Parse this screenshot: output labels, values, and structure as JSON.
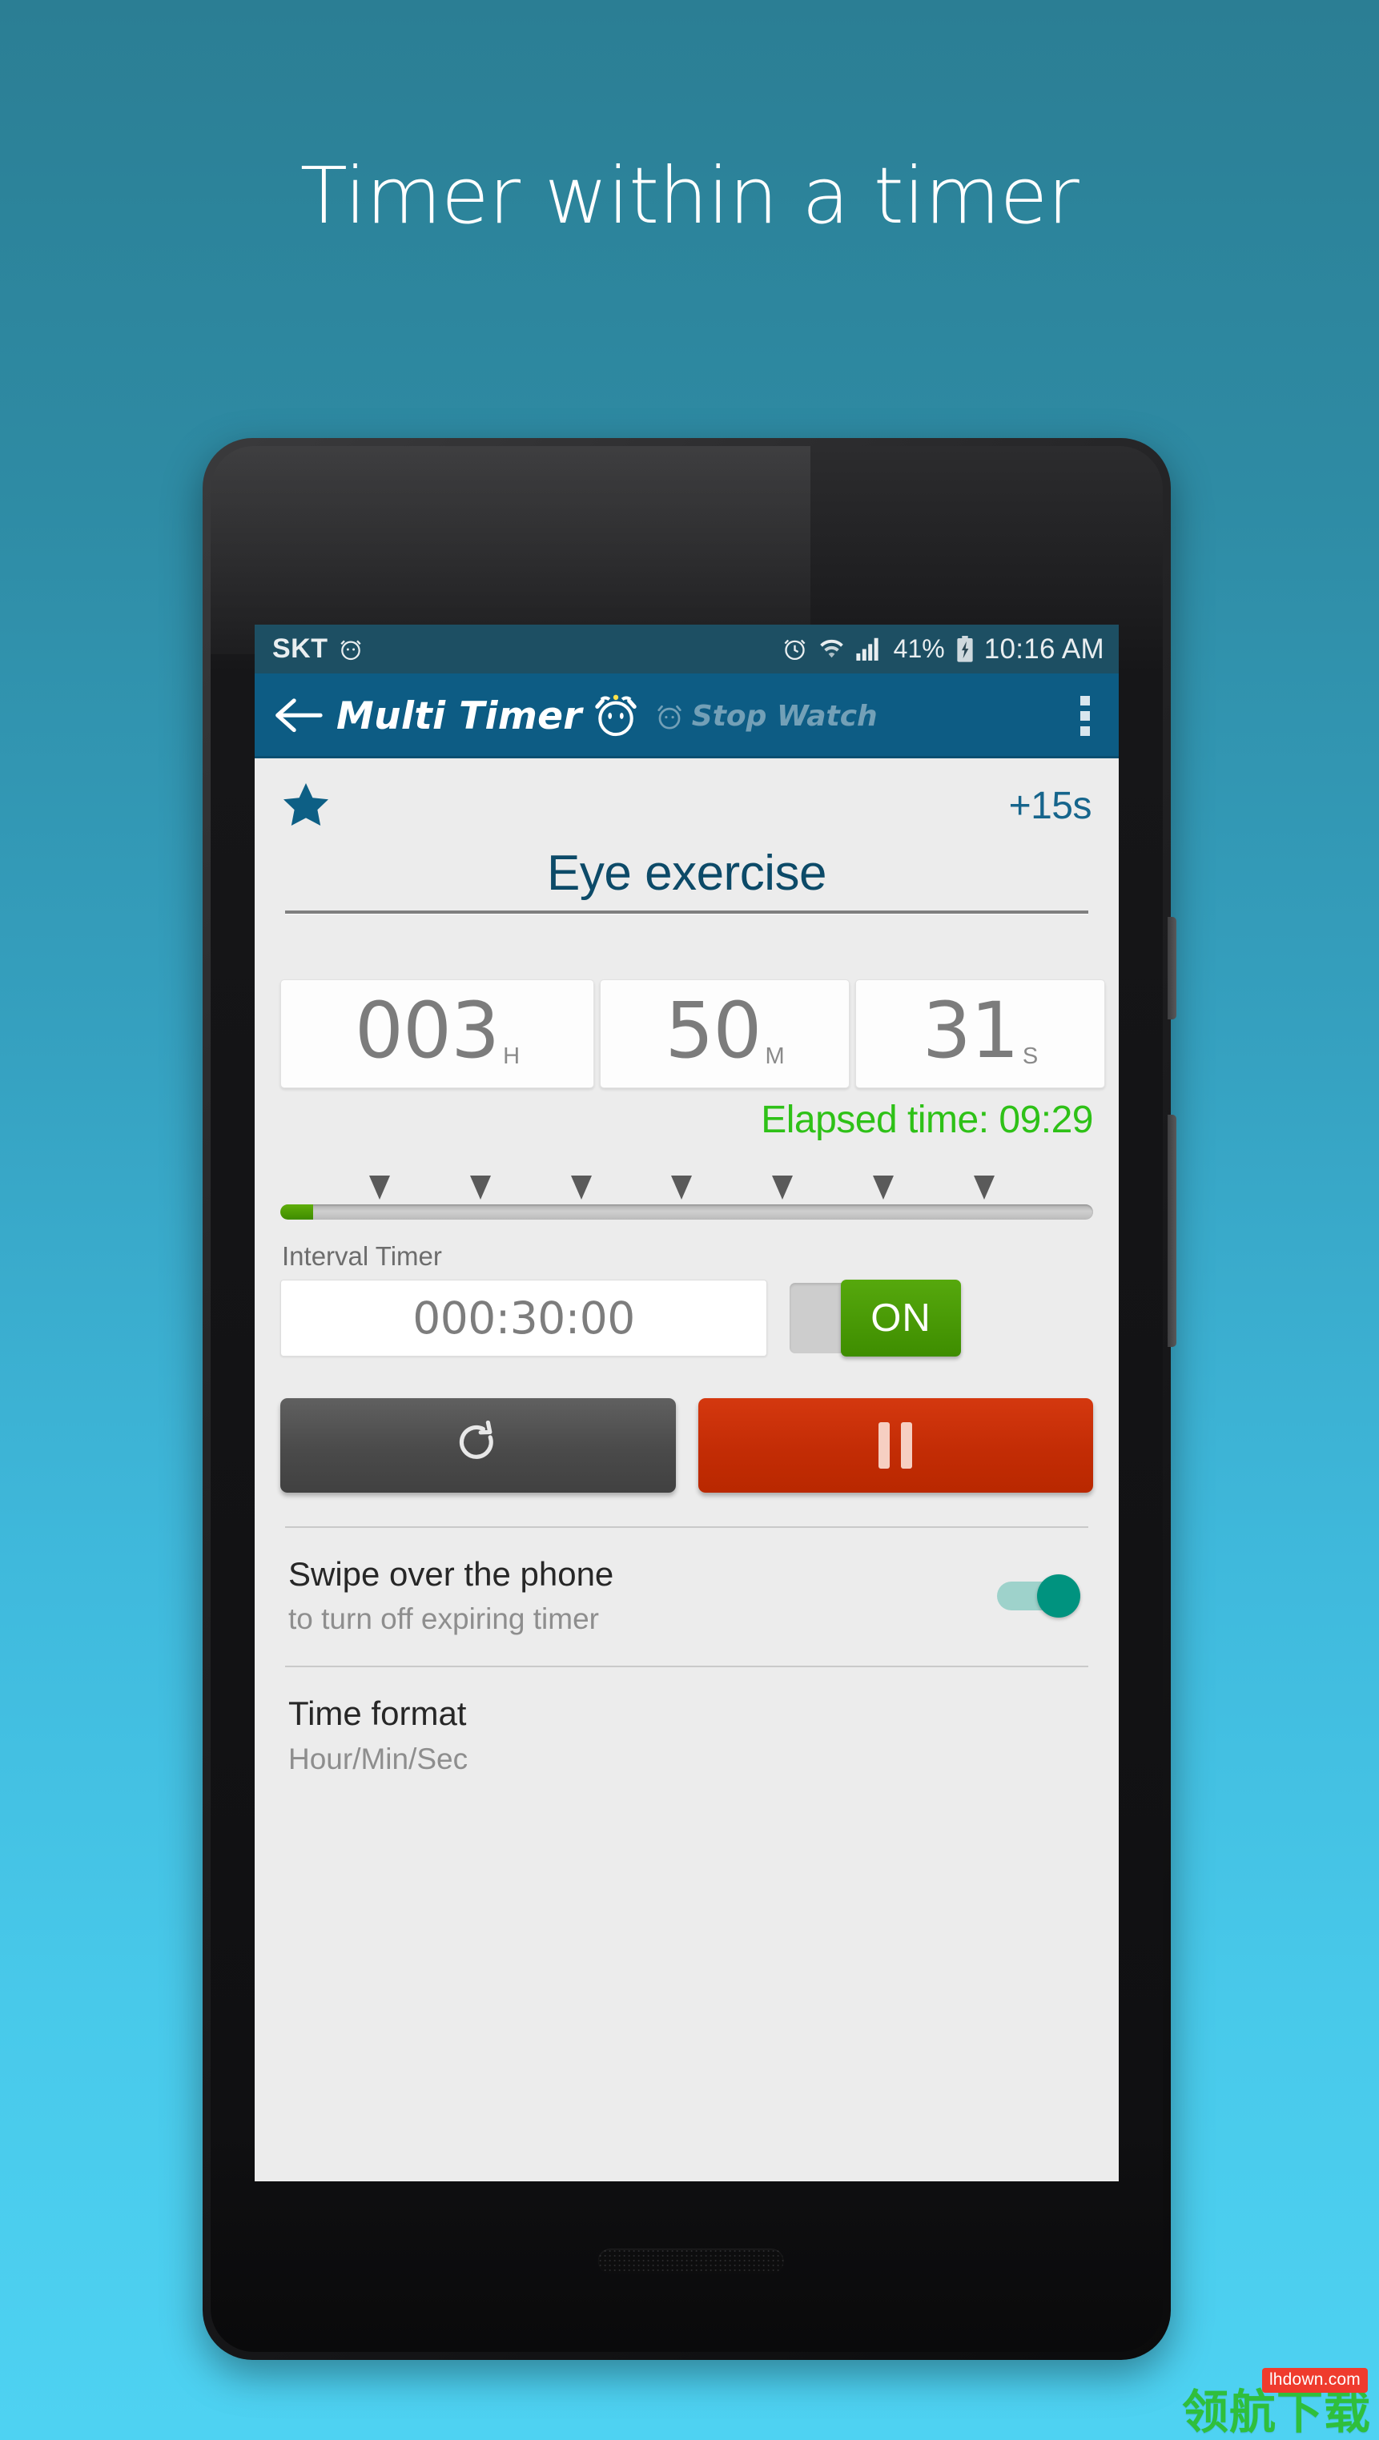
{
  "promo": {
    "headline": "Timer within a timer"
  },
  "statusbar": {
    "carrier": "SKT",
    "carrier_icon": "alarm-clock-icon",
    "alarm_icon": "alarm-clock-icon",
    "wifi_icon": "wifi-icon",
    "signal_icon": "cellular-signal-icon",
    "battery_percent": "41%",
    "battery_icon": "battery-charging-icon",
    "clock": "10:16 AM"
  },
  "appbar": {
    "back_icon": "back-arrow-icon",
    "title": "Multi Timer",
    "logo_icon": "alarm-clock-face-icon",
    "tab_stopwatch_icon": "stopwatch-icon",
    "tab_stopwatch_label": "Stop Watch",
    "overflow_icon": "overflow-menu-icon",
    "bar_color": "#0d5c84"
  },
  "timer": {
    "favorite_icon": "star-icon",
    "add_time_label": "+15s",
    "name": "Eye exercise",
    "digits": [
      {
        "value": "003",
        "unit": "H",
        "name": "hours"
      },
      {
        "value": "50",
        "unit": "M",
        "name": "minutes"
      },
      {
        "value": "31",
        "unit": "S",
        "name": "seconds"
      }
    ],
    "elapsed_label": "Elapsed time: 09:29",
    "elapsed_color": "#2ec117",
    "progress_percent": 4,
    "marker_positions": [
      12.2,
      24.6,
      37.0,
      49.4,
      61.8,
      74.2,
      86.6
    ]
  },
  "interval": {
    "label": "Interval Timer",
    "value": "000:30:00",
    "toggle_label": "ON",
    "toggle_on": true,
    "toggle_color": "#46960a"
  },
  "actions": {
    "reset_icon": "reset-refresh-icon",
    "reset_name": "reset-button",
    "pause_icon": "pause-icon",
    "pause_name": "pause-button",
    "pause_color": "#c32c05"
  },
  "settings": [
    {
      "title": "Swipe over the phone",
      "subtitle": "to turn off expiring timer",
      "has_toggle": true,
      "toggle_on": true,
      "toggle_color": "#00937f"
    },
    {
      "title": "Time format",
      "subtitle": "Hour/Min/Sec",
      "has_toggle": false
    }
  ],
  "watermark": {
    "text": "领航下载",
    "badge": "lhdown.com",
    "text_color": "#2fbf3c",
    "badge_color": "#ef3b2d"
  }
}
